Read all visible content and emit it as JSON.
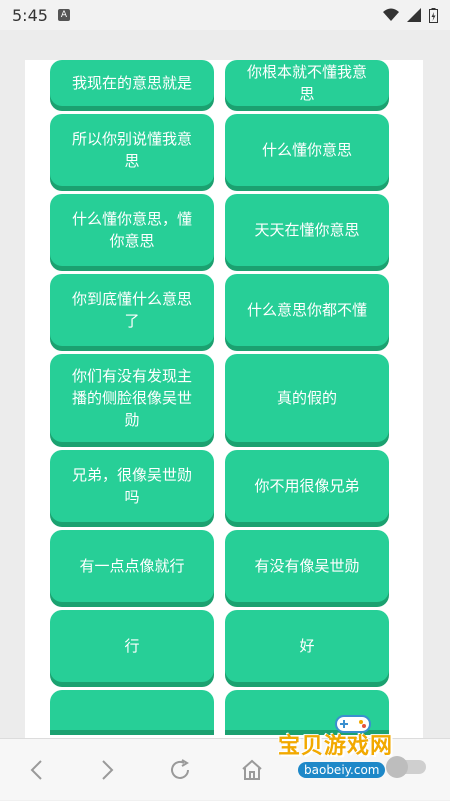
{
  "status_bar": {
    "time": "5:45",
    "notification_letter": "A"
  },
  "phrases": [
    [
      "我现在的意思就是",
      "你根本就不懂我意思"
    ],
    [
      "所以你别说懂我意思",
      "什么懂你意思"
    ],
    [
      "什么懂你意思，懂你意思",
      "天天在懂你意思"
    ],
    [
      "你到底懂什么意思了",
      "什么意思你都不懂"
    ],
    [
      "你们有没有发现主播的侧脸很像吴世勋",
      "真的假的"
    ],
    [
      "兄弟，很像吴世勋吗",
      "你不用很像兄弟"
    ],
    [
      "有一点点像就行",
      "有没有像吴世勋"
    ],
    [
      "行",
      "好"
    ]
  ],
  "watermark": {
    "brand": "宝贝游戏网",
    "url": "baobeiy.com"
  },
  "colors": {
    "button": "#27cf97",
    "button_shadow": "#1ba170",
    "watermark": "#f2a900"
  }
}
